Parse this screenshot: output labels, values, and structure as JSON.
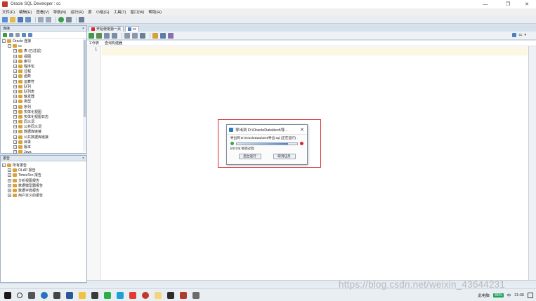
{
  "window": {
    "title": "Oracle SQL Developer : cc",
    "minimize": "—",
    "maximize": "❐",
    "close": "✕"
  },
  "menu": [
    "文件(F)",
    "编辑(E)",
    "查看(V)",
    "导航(N)",
    "运行(R)",
    "源",
    "小组(G)",
    "工具(T)",
    "窗口(W)",
    "帮助(H)"
  ],
  "connections_pane": {
    "header": "连接",
    "tree": [
      {
        "label": "Oracle 连接",
        "level": 0,
        "exp": "−"
      },
      {
        "label": "cc",
        "level": 1,
        "exp": "−"
      },
      {
        "label": "表 (已过滤)",
        "level": 2,
        "exp": "+"
      },
      {
        "label": "视图",
        "level": 2,
        "exp": "+"
      },
      {
        "label": "索引",
        "level": 2,
        "exp": "+"
      },
      {
        "label": "程序包",
        "level": 2,
        "exp": "+"
      },
      {
        "label": "过程",
        "level": 2,
        "exp": "+"
      },
      {
        "label": "函数",
        "level": 2,
        "exp": "+"
      },
      {
        "label": "运算符",
        "level": 2,
        "exp": "+"
      },
      {
        "label": "队列",
        "level": 2,
        "exp": "+"
      },
      {
        "label": "队列表",
        "level": 2,
        "exp": "+"
      },
      {
        "label": "触发器",
        "level": 2,
        "exp": "+"
      },
      {
        "label": "类型",
        "level": 2,
        "exp": "+"
      },
      {
        "label": "序列",
        "level": 2,
        "exp": "+"
      },
      {
        "label": "实体化视图",
        "level": 2,
        "exp": "+"
      },
      {
        "label": "实体化视图日志",
        "level": 2,
        "exp": "+"
      },
      {
        "label": "同义词",
        "level": 2,
        "exp": "+"
      },
      {
        "label": "公共同义词",
        "level": 2,
        "exp": "+"
      },
      {
        "label": "数据库链接",
        "level": 2,
        "exp": "+"
      },
      {
        "label": "公共数据库链接",
        "level": 2,
        "exp": "+"
      },
      {
        "label": "目录",
        "level": 2,
        "exp": "+"
      },
      {
        "label": "版本",
        "level": 2,
        "exp": "+"
      },
      {
        "label": "Java",
        "level": 2,
        "exp": "+"
      }
    ]
  },
  "reports_pane": {
    "header": "报告",
    "tree": [
      {
        "label": "所有报告",
        "level": 0,
        "exp": "−"
      },
      {
        "label": "OLAP 报告",
        "level": 1,
        "exp": "+"
      },
      {
        "label": "TimesTen 报告",
        "level": 1,
        "exp": "+"
      },
      {
        "label": "分析视图报告",
        "level": 1,
        "exp": "+"
      },
      {
        "label": "数据模型器报告",
        "level": 1,
        "exp": "+"
      },
      {
        "label": "数据字典报告",
        "level": 1,
        "exp": "+"
      },
      {
        "label": "用户定义的报告",
        "level": 1,
        "exp": "+"
      }
    ]
  },
  "editor": {
    "tabs": [
      {
        "label": "开始使用第一页"
      },
      {
        "label": "cc"
      }
    ],
    "connection_select": "cc",
    "subtabs": [
      "工作表",
      "查询构建器"
    ],
    "line_number": "1"
  },
  "export_dialog": {
    "title": "导出到 D:\\OracleData\\test\\导...",
    "path_text": "导出到 D:\\OracleData\\test\\导出.sql (正在运行)",
    "progress": 0.85,
    "status": "[00:03] 协调过程",
    "run_in_background": "后台运行",
    "cancel_task": "取消任务"
  },
  "taskbar": {
    "tray": {
      "computer": "此电脑",
      "battery": "36%",
      "ime": "中",
      "time": "21:36"
    }
  },
  "watermark": "https://blog.csdn.net/weixin_43644231",
  "colors": {
    "highlight": "#d9262c",
    "tree_icon": "#d8a23c",
    "progress": "#4f83c9"
  }
}
